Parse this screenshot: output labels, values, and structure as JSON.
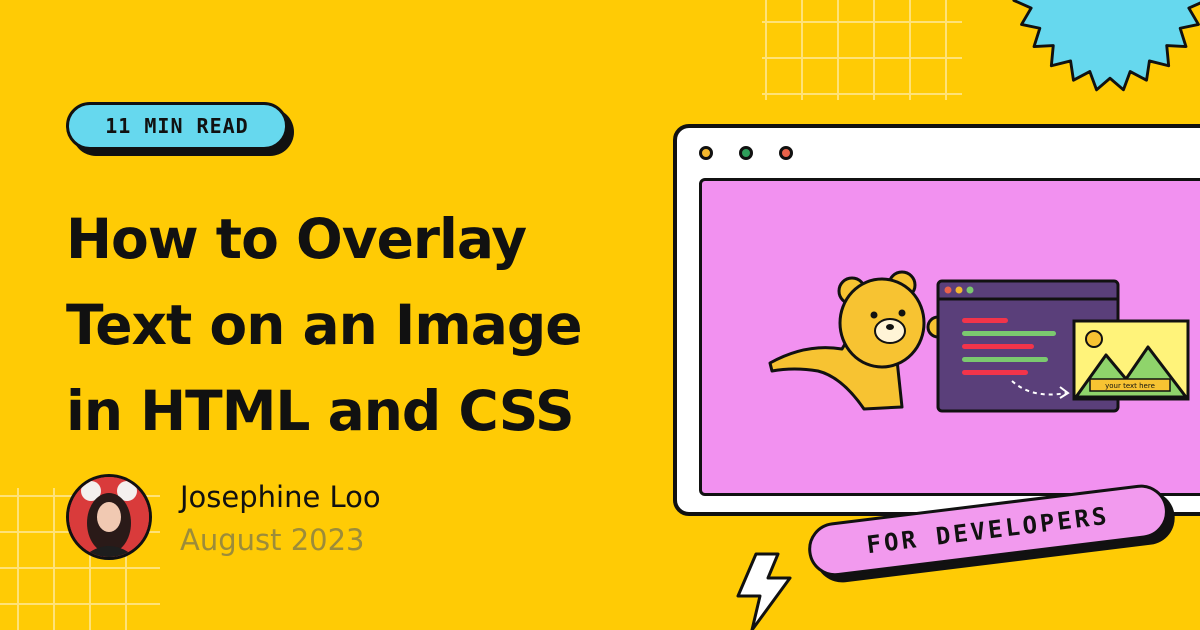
{
  "badge": {
    "read_time": "11 MIN READ"
  },
  "article": {
    "title_lines": [
      "How to Overlay",
      "Text on an Image",
      "in HTML and CSS"
    ]
  },
  "author": {
    "name": "Josephine Loo",
    "date": "August 2023"
  },
  "illustration": {
    "overlay_text": "your text here",
    "tag_label": "FOR DEVELOPERS",
    "window_dot_colors": [
      "#F5B82E",
      "#2E9E5A",
      "#E8624A"
    ]
  },
  "colors": {
    "background": "#FFCB05",
    "badge": "#66D8EE",
    "browser_screen": "#F291F0",
    "tag": "#F29AEE",
    "bear": "#F7C332",
    "sunburst": "#66D8EE",
    "date_text": "#9C8C3A"
  }
}
